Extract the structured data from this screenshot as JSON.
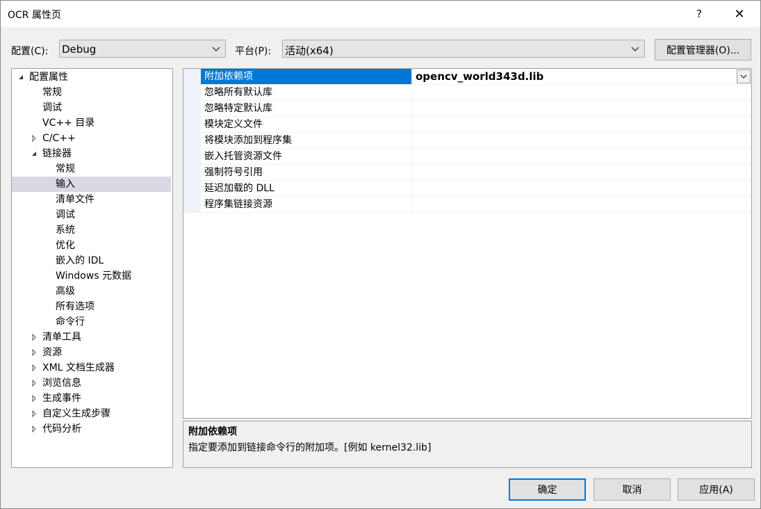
{
  "window": {
    "title": "OCR 属性页",
    "help": "?",
    "close": "✕"
  },
  "config": {
    "config_label": "配置(C):",
    "config_value": "Debug",
    "platform_label": "平台(P):",
    "platform_value": "活动(x64)",
    "manager_button": "配置管理器(O)..."
  },
  "tree": {
    "items": [
      {
        "label": "配置属性",
        "expander": "expanded"
      },
      {
        "label": "常规"
      },
      {
        "label": "调试"
      },
      {
        "label": "VC++ 目录"
      },
      {
        "label": "C/C++",
        "expander": "collapsed"
      },
      {
        "label": "链接器",
        "expander": "expanded"
      },
      {
        "label": "常规"
      },
      {
        "label": "输入",
        "selected": true
      },
      {
        "label": "清单文件"
      },
      {
        "label": "调试"
      },
      {
        "label": "系统"
      },
      {
        "label": "优化"
      },
      {
        "label": "嵌入的 IDL"
      },
      {
        "label": "Windows 元数据"
      },
      {
        "label": "高级"
      },
      {
        "label": "所有选项"
      },
      {
        "label": "命令行"
      },
      {
        "label": "清单工具",
        "expander": "collapsed"
      },
      {
        "label": "资源",
        "expander": "collapsed"
      },
      {
        "label": "XML 文档生成器",
        "expander": "collapsed"
      },
      {
        "label": "浏览信息",
        "expander": "collapsed"
      },
      {
        "label": "生成事件",
        "expander": "collapsed"
      },
      {
        "label": "自定义生成步骤",
        "expander": "collapsed"
      },
      {
        "label": "代码分析",
        "expander": "collapsed"
      }
    ]
  },
  "properties": {
    "rows": [
      {
        "name": "附加依赖项",
        "value": "opencv_world343d.lib",
        "selected": true
      },
      {
        "name": "忽略所有默认库",
        "value": ""
      },
      {
        "name": "忽略特定默认库",
        "value": ""
      },
      {
        "name": "模块定义文件",
        "value": ""
      },
      {
        "name": "将模块添加到程序集",
        "value": ""
      },
      {
        "name": "嵌入托管资源文件",
        "value": ""
      },
      {
        "name": "强制符号引用",
        "value": ""
      },
      {
        "name": "延迟加载的 DLL",
        "value": ""
      },
      {
        "name": "程序集链接资源",
        "value": ""
      }
    ]
  },
  "description": {
    "title": "附加依赖项",
    "text": "指定要添加到链接命令行的附加项。[例如 kernel32.lib]"
  },
  "buttons": {
    "ok": "确定",
    "cancel": "取消",
    "apply": "应用(A)"
  },
  "colors": {
    "accent": "#0078d7",
    "selected_tree": "#d9d9e3"
  }
}
